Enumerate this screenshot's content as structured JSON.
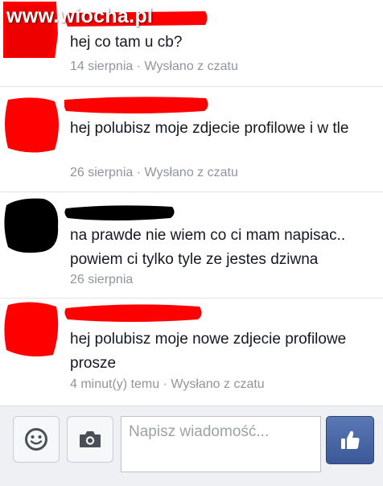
{
  "watermark": "www.wiocha.pl",
  "messages": [
    {
      "text": "hej co tam u cb?",
      "time": "14 sierpnia",
      "source": "Wysłano z czatu"
    },
    {
      "text": "hej polubisz moje zdjecie profilowe i w tle",
      "time": "26 sierpnia",
      "source": "Wysłano z czatu"
    },
    {
      "text": "na prawde nie wiem co ci mam napisac.. powiem ci tylko tyle ze jestes dziwna",
      "time": "26 sierpnia",
      "source": ""
    },
    {
      "text": "hej polubisz moje nowe zdjecie profilowe prosze",
      "time": "4 minut(y) temu",
      "source": "Wysłano z czatu"
    }
  ],
  "meta_separator": " · ",
  "composer": {
    "placeholder": "Napisz wiadomość..."
  },
  "icons": {
    "emoji": "smiley-icon",
    "camera": "camera-icon",
    "like": "thumbs-up-icon"
  },
  "colors": {
    "redaction_red": "#ff0000",
    "redaction_black": "#000000",
    "like_button": "#3b5998",
    "meta_text": "#90949c"
  }
}
